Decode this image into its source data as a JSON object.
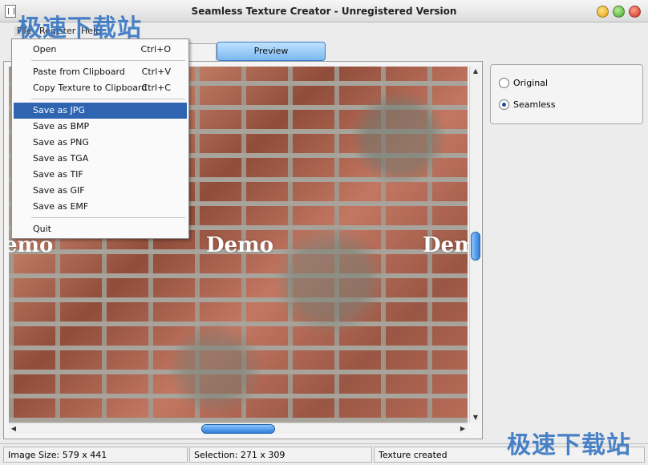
{
  "window": {
    "title": "Seamless Texture Creator - Unregistered Version"
  },
  "watermark": "极速下载站",
  "menubar": {
    "file": "File",
    "register": "Register",
    "help": "Help"
  },
  "file_menu": {
    "open": {
      "label": "Open",
      "shortcut": "Ctrl+O"
    },
    "paste": {
      "label": "Paste from Clipboard",
      "shortcut": "Ctrl+V"
    },
    "copy": {
      "label": "Copy Texture to Clipboard",
      "shortcut": "Ctrl+C"
    },
    "save_jpg": "Save as JPG",
    "save_bmp": "Save as BMP",
    "save_png": "Save as PNG",
    "save_tga": "Save as TGA",
    "save_tif": "Save as TIF",
    "save_gif": "Save as GIF",
    "save_emf": "Save as EMF",
    "quit": "Quit"
  },
  "tabs": {
    "preview": "Preview"
  },
  "texture": {
    "watermark_1": "emo",
    "watermark_2": "Demo",
    "watermark_3": "Dem"
  },
  "mode": {
    "original": "Original",
    "seamless": "Seamless",
    "selected": "Seamless"
  },
  "status": {
    "image_size": "Image Size: 579 x 441",
    "selection": "Selection: 271 x 309",
    "message": "Texture created"
  }
}
